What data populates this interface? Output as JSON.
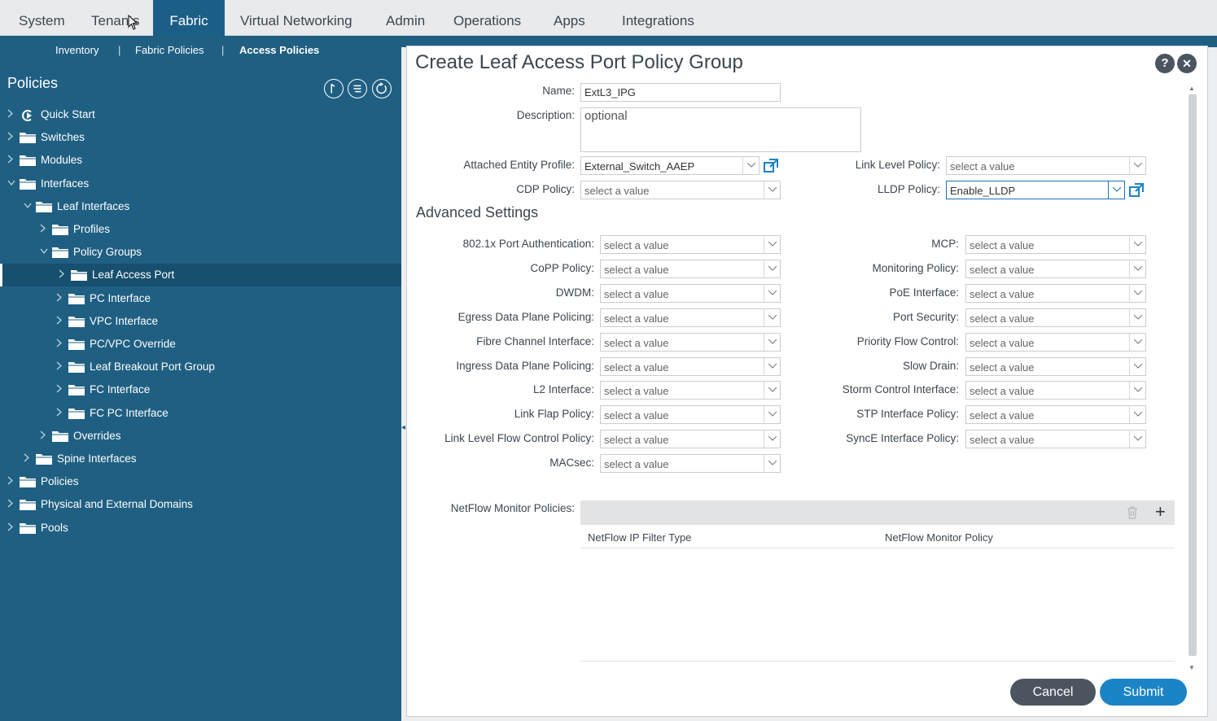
{
  "topnav": {
    "tabs": [
      "System",
      "Tenants",
      "Fabric",
      "Virtual Networking",
      "Admin",
      "Operations",
      "Apps",
      "Integrations"
    ],
    "active": "Fabric"
  },
  "subnav": {
    "inventory": "Inventory",
    "fabric_policies": "Fabric Policies",
    "access_policies": "Access Policies",
    "separator": "|"
  },
  "sidebar": {
    "title": "Policies",
    "items": [
      {
        "label": "Quick Start"
      },
      {
        "label": "Switches"
      },
      {
        "label": "Modules"
      },
      {
        "label": "Interfaces"
      },
      {
        "label": "Leaf Interfaces"
      },
      {
        "label": "Profiles"
      },
      {
        "label": "Policy Groups"
      },
      {
        "label": "Leaf Access Port"
      },
      {
        "label": "PC Interface"
      },
      {
        "label": "VPC Interface"
      },
      {
        "label": "PC/VPC Override"
      },
      {
        "label": "Leaf Breakout Port Group"
      },
      {
        "label": "FC Interface"
      },
      {
        "label": "FC PC Interface"
      },
      {
        "label": "Overrides"
      },
      {
        "label": "Spine Interfaces"
      },
      {
        "label": "Policies"
      },
      {
        "label": "Physical and External Domains"
      },
      {
        "label": "Pools"
      }
    ]
  },
  "dialog": {
    "title": "Create Leaf Access Port Policy Group",
    "help": "?",
    "close": "✕",
    "name_label": "Name:",
    "name_value": "ExtL3_IPG",
    "description_label": "Description:",
    "description_placeholder": "optional",
    "aep_label": "Attached Entity Profile:",
    "aep_value": "External_Switch_AAEP",
    "cdp_label": "CDP Policy:",
    "link_level_label": "Link Level Policy:",
    "lldp_label": "LLDP Policy:",
    "lldp_value": "Enable_LLDP",
    "placeholder": "select a value",
    "advanced_title": "Advanced Settings",
    "left_fields": [
      "802.1x Port Authentication:",
      "CoPP Policy:",
      "DWDM:",
      "Egress Data Plane Policing:",
      "Fibre Channel Interface:",
      "Ingress Data Plane Policing:",
      "L2 Interface:",
      "Link Flap Policy:",
      "Link Level Flow Control Policy:",
      "MACsec:"
    ],
    "right_fields": [
      "MCP:",
      "Monitoring Policy:",
      "PoE Interface:",
      "Port Security:",
      "Priority Flow Control:",
      "Slow Drain:",
      "Storm Control Interface:",
      "STP Interface Policy:",
      "SyncE Interface Policy:"
    ],
    "netflow_label": "NetFlow Monitor Policies:",
    "netflow_col1": "NetFlow IP Filter Type",
    "netflow_col2": "NetFlow Monitor Policy",
    "add": "+",
    "cancel": "Cancel",
    "submit": "Submit"
  }
}
